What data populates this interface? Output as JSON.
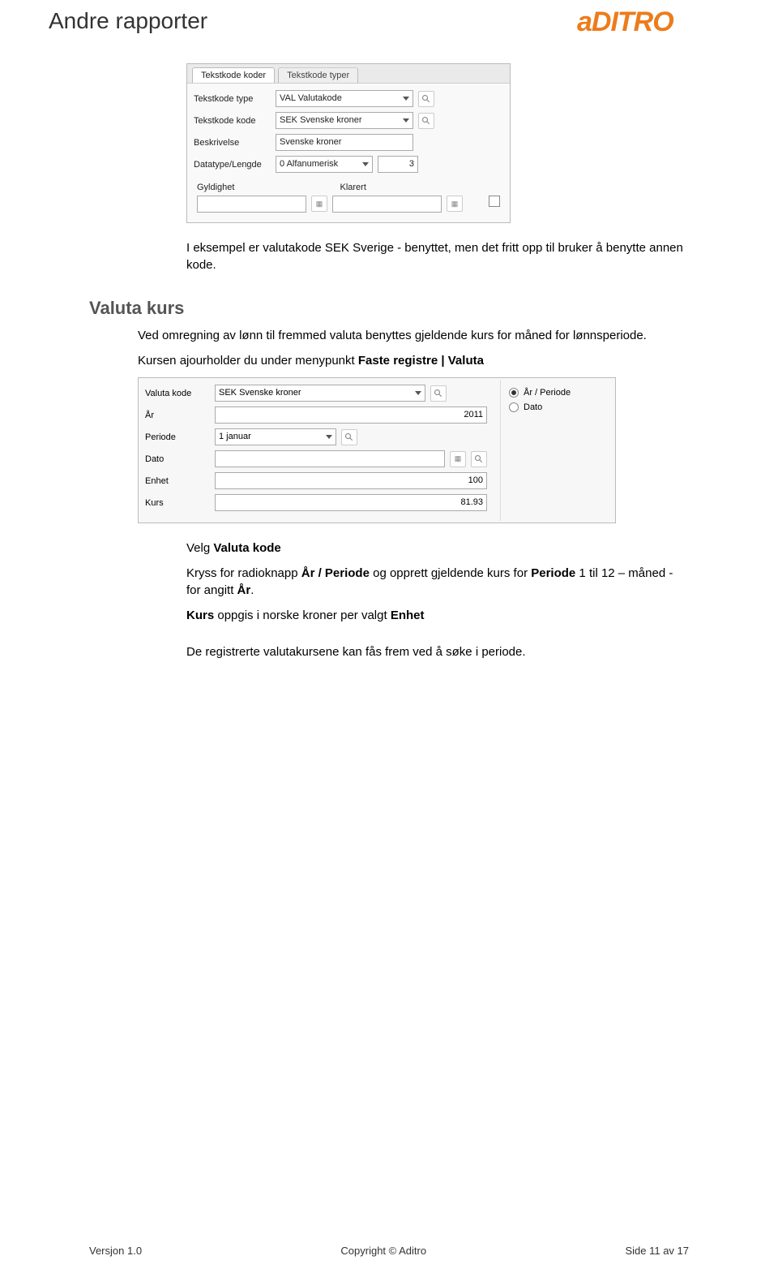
{
  "header": {
    "title": "Andre rapporter",
    "logo_text": "aDITRO"
  },
  "paragraphs": {
    "p1": "I eksempel er valutakode SEK Sverige - benyttet, men det fritt opp til bruker å benytte annen kode.",
    "section_h2": "Valuta kurs",
    "p2": "Ved omregning av lønn til fremmed valuta benyttes gjeldende kurs for måned for lønnsperiode.",
    "p3a": "Kursen ajourholder du under menypunkt ",
    "p3b": "Faste registre | Valuta",
    "p4a": "Velg ",
    "p4b": "Valuta kode",
    "p5a": "Kryss for radioknapp ",
    "p5b": "År / Periode",
    "p5c": " og opprett gjeldende kurs for ",
    "p5d": "Periode",
    "p5e": " 1 til 12 – måned - for angitt ",
    "p5f": "År",
    "p5g": ".",
    "p6a": "Kurs",
    "p6b": " oppgis i norske kroner per valgt ",
    "p6c": "Enhet",
    "p7": "De registrerte valutakursene kan fås frem ved å søke i periode."
  },
  "figure1": {
    "tabs": {
      "active": "Tekstkode koder",
      "inactive": "Tekstkode typer"
    },
    "rows": {
      "type_label": "Tekstkode type",
      "type_value": "VAL Valutakode",
      "kode_label": "Tekstkode kode",
      "kode_value": "SEK Svenske kroner",
      "besk_label": "Beskrivelse",
      "besk_value": "Svenske kroner",
      "dtype_label": "Datatype/Lengde",
      "dtype_value": "0 Alfanumerisk",
      "dtype_len": "3"
    },
    "subhead": {
      "gyldighet": "Gyldighet",
      "klarert": "Klarert"
    }
  },
  "figure2": {
    "rows": {
      "valutakode_label": "Valuta kode",
      "valutakode_value": "SEK Svenske kroner",
      "ar_label": "År",
      "ar_value": "2011",
      "periode_label": "Periode",
      "periode_value": "1 januar",
      "dato_label": "Dato",
      "dato_value": "",
      "enhet_label": "Enhet",
      "enhet_value": "100",
      "kurs_label": "Kurs",
      "kurs_value": "81.93"
    },
    "radios": {
      "opt1": "År / Periode",
      "opt2": "Dato"
    }
  },
  "footer": {
    "left": "Versjon 1.0",
    "center": "Copyright © Aditro",
    "right": "Side 11 av 17"
  }
}
